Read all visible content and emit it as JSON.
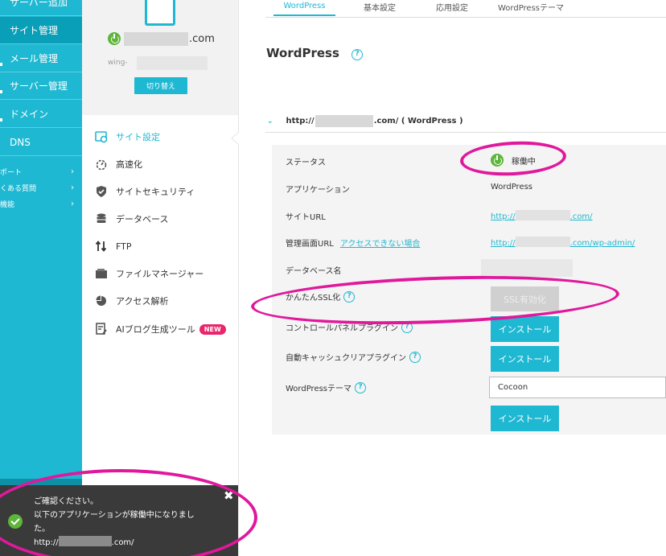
{
  "leftnav": {
    "items": [
      {
        "label": "サーバー追加"
      },
      {
        "label": "サイト管理"
      },
      {
        "label": "メール管理"
      },
      {
        "label": "サーバー管理"
      },
      {
        "label": "ドメイン"
      },
      {
        "label": "DNS"
      }
    ],
    "small_items": [
      {
        "label": "ポート"
      },
      {
        "label": "くある質問"
      },
      {
        "label": "機能"
      }
    ]
  },
  "site_panel": {
    "domain_suffix": ".com",
    "server_prefix": "wing-",
    "switch_label": "切り替え",
    "menu": [
      {
        "label": "サイト設定",
        "icon": "gear-icon"
      },
      {
        "label": "高速化",
        "icon": "stopwatch-icon"
      },
      {
        "label": "サイトセキュリティ",
        "icon": "shield-check-icon"
      },
      {
        "label": "データベース",
        "icon": "database-icon"
      },
      {
        "label": "FTP",
        "icon": "transfer-arrows-icon"
      },
      {
        "label": "ファイルマネージャー",
        "icon": "folder-icon"
      },
      {
        "label": "アクセス解析",
        "icon": "pie-chart-icon"
      },
      {
        "label": "AIブログ生成ツール",
        "icon": "document-edit-icon",
        "badge": "NEW"
      }
    ]
  },
  "tabs": [
    {
      "label": "WordPress"
    },
    {
      "label": "基本設定"
    },
    {
      "label": "応用設定"
    },
    {
      "label": "WordPressテーマ"
    }
  ],
  "page_title": "WordPress",
  "section": {
    "header_prefix": "http://",
    "header_suffix": ".com/ ( WordPress )"
  },
  "rows": {
    "status_label": "ステータス",
    "status_value": "稼働中",
    "application_label": "アプリケーション",
    "application_value": "WordPress",
    "site_url_label": "サイトURL",
    "site_url_prefix": "http://",
    "site_url_suffix": ".com/",
    "admin_url_label": "管理画面URL",
    "admin_url_link": "アクセスできない場合",
    "admin_url_prefix": "http://",
    "admin_url_suffix": ".com/wp-admin/",
    "database_label": "データベース名",
    "ssl_label": "かんたんSSL化",
    "ssl_button": "SSL有効化",
    "cp_plugin_label": "コントロールパネルプラグイン",
    "install_1": "インストール",
    "cache_plugin_label": "自動キャッシュクリアプラグイン",
    "install_2": "インストール",
    "theme_label": "WordPressテーマ",
    "theme_value": "Cocoon",
    "install_3": "インストール"
  },
  "toast": {
    "line1": "ご確認ください。",
    "line2": "以下のアプリケーションが稼働中になりまし",
    "line3": "た。",
    "url_prefix": "http://",
    "url_suffix": ".com/"
  },
  "colors": {
    "accent": "#1fb8d2",
    "status_green": "#5db53a",
    "annotation_magenta": "#e0189c",
    "new_badge": "#e8266c"
  }
}
